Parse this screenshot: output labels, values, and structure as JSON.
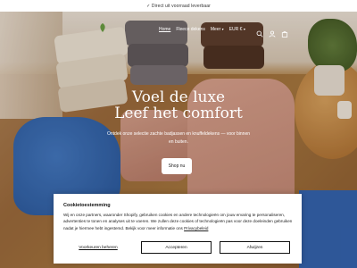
{
  "announcement": "✓ Direct uit voorraad leverbaar",
  "logo": {
    "text": ""
  },
  "nav": {
    "items": [
      {
        "label": "Home",
        "active": true
      },
      {
        "label": "Fleece dekens",
        "active": false
      },
      {
        "label": "Meer",
        "active": false,
        "dropdown": true
      }
    ],
    "currency": "EUR €",
    "icons": [
      "search-icon",
      "account-icon",
      "cart-icon"
    ]
  },
  "hero": {
    "title_line1": "Voel de luxe",
    "title_line2": "Leef het comfort",
    "subtitle": "Ontdek onze selectie zachte badjassen en knuffeldekens — voor binnen en buiten.",
    "cta": "Shop nu"
  },
  "cookie": {
    "title": "Cookietoestemming",
    "text": "Wij en onze partners, waaronder Shopify, gebruiken cookies en andere technologieën om jouw ervaring te personaliseren, advertenties te tonen en analyses uit te voeren. We zullen deze cookies of technologieën pas voor deze doeleinden gebruiken nadat je hiermee hebt ingestemd. Bekijk voor meer informatie ons",
    "link": "Privacybeleid",
    "manage": "Voorkeuren beheren",
    "accept": "Accepteren",
    "reject": "Afwijzen"
  },
  "colors": {
    "announcement_bg": "#ffffff",
    "cta_bg": "#ffffff",
    "logo_green": "#5d8a3a"
  }
}
